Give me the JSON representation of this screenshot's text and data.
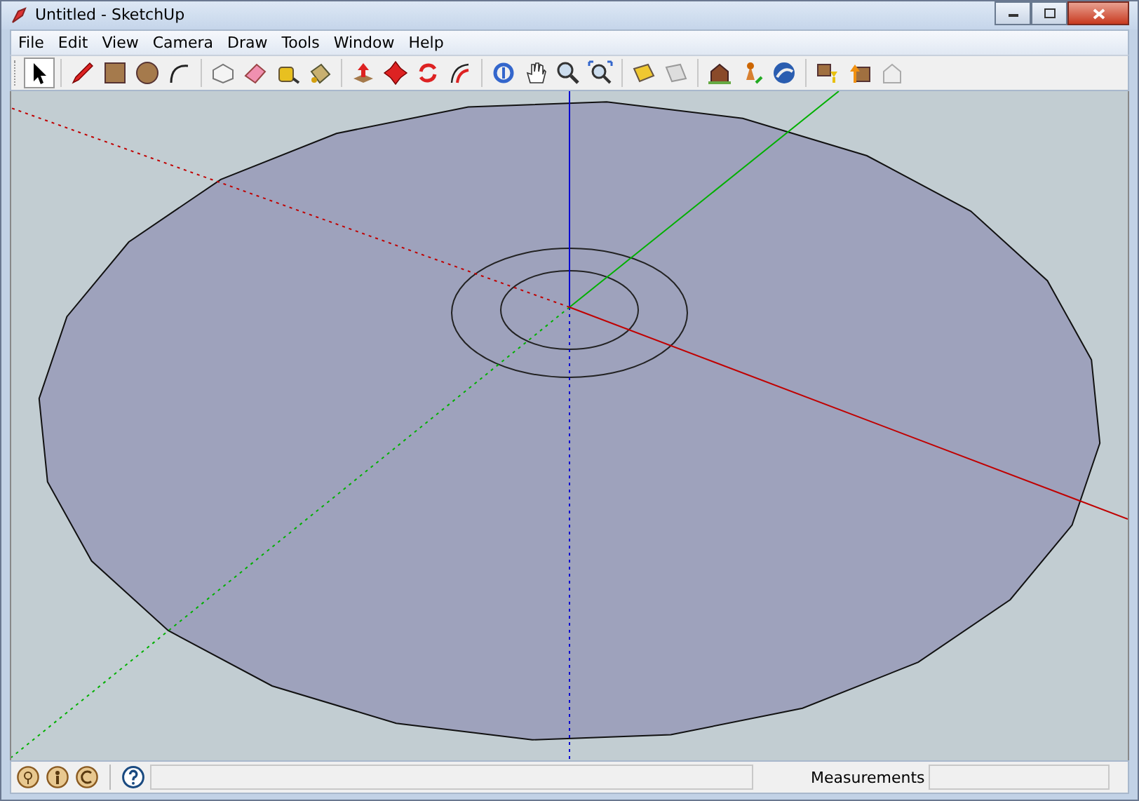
{
  "window": {
    "title": "Untitled - SketchUp"
  },
  "menu": [
    "File",
    "Edit",
    "View",
    "Camera",
    "Draw",
    "Tools",
    "Window",
    "Help"
  ],
  "status_bar": {
    "measurements_label": "Measurements"
  }
}
